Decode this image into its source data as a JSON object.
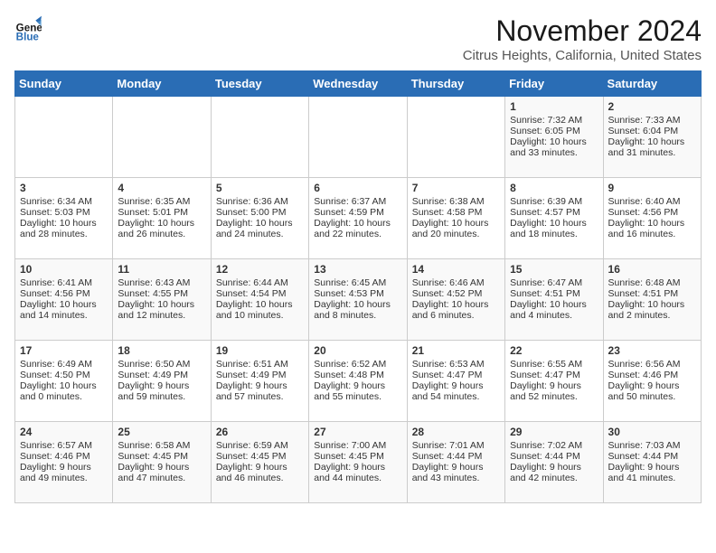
{
  "logo": {
    "line1": "General",
    "line2": "Blue"
  },
  "title": "November 2024",
  "subtitle": "Citrus Heights, California, United States",
  "days_of_week": [
    "Sunday",
    "Monday",
    "Tuesday",
    "Wednesday",
    "Thursday",
    "Friday",
    "Saturday"
  ],
  "weeks": [
    [
      {
        "day": "",
        "sunrise": "",
        "sunset": "",
        "daylight": ""
      },
      {
        "day": "",
        "sunrise": "",
        "sunset": "",
        "daylight": ""
      },
      {
        "day": "",
        "sunrise": "",
        "sunset": "",
        "daylight": ""
      },
      {
        "day": "",
        "sunrise": "",
        "sunset": "",
        "daylight": ""
      },
      {
        "day": "",
        "sunrise": "",
        "sunset": "",
        "daylight": ""
      },
      {
        "day": "1",
        "sunrise": "Sunrise: 7:32 AM",
        "sunset": "Sunset: 6:05 PM",
        "daylight": "Daylight: 10 hours and 33 minutes."
      },
      {
        "day": "2",
        "sunrise": "Sunrise: 7:33 AM",
        "sunset": "Sunset: 6:04 PM",
        "daylight": "Daylight: 10 hours and 31 minutes."
      }
    ],
    [
      {
        "day": "3",
        "sunrise": "Sunrise: 6:34 AM",
        "sunset": "Sunset: 5:03 PM",
        "daylight": "Daylight: 10 hours and 28 minutes."
      },
      {
        "day": "4",
        "sunrise": "Sunrise: 6:35 AM",
        "sunset": "Sunset: 5:01 PM",
        "daylight": "Daylight: 10 hours and 26 minutes."
      },
      {
        "day": "5",
        "sunrise": "Sunrise: 6:36 AM",
        "sunset": "Sunset: 5:00 PM",
        "daylight": "Daylight: 10 hours and 24 minutes."
      },
      {
        "day": "6",
        "sunrise": "Sunrise: 6:37 AM",
        "sunset": "Sunset: 4:59 PM",
        "daylight": "Daylight: 10 hours and 22 minutes."
      },
      {
        "day": "7",
        "sunrise": "Sunrise: 6:38 AM",
        "sunset": "Sunset: 4:58 PM",
        "daylight": "Daylight: 10 hours and 20 minutes."
      },
      {
        "day": "8",
        "sunrise": "Sunrise: 6:39 AM",
        "sunset": "Sunset: 4:57 PM",
        "daylight": "Daylight: 10 hours and 18 minutes."
      },
      {
        "day": "9",
        "sunrise": "Sunrise: 6:40 AM",
        "sunset": "Sunset: 4:56 PM",
        "daylight": "Daylight: 10 hours and 16 minutes."
      }
    ],
    [
      {
        "day": "10",
        "sunrise": "Sunrise: 6:41 AM",
        "sunset": "Sunset: 4:56 PM",
        "daylight": "Daylight: 10 hours and 14 minutes."
      },
      {
        "day": "11",
        "sunrise": "Sunrise: 6:43 AM",
        "sunset": "Sunset: 4:55 PM",
        "daylight": "Daylight: 10 hours and 12 minutes."
      },
      {
        "day": "12",
        "sunrise": "Sunrise: 6:44 AM",
        "sunset": "Sunset: 4:54 PM",
        "daylight": "Daylight: 10 hours and 10 minutes."
      },
      {
        "day": "13",
        "sunrise": "Sunrise: 6:45 AM",
        "sunset": "Sunset: 4:53 PM",
        "daylight": "Daylight: 10 hours and 8 minutes."
      },
      {
        "day": "14",
        "sunrise": "Sunrise: 6:46 AM",
        "sunset": "Sunset: 4:52 PM",
        "daylight": "Daylight: 10 hours and 6 minutes."
      },
      {
        "day": "15",
        "sunrise": "Sunrise: 6:47 AM",
        "sunset": "Sunset: 4:51 PM",
        "daylight": "Daylight: 10 hours and 4 minutes."
      },
      {
        "day": "16",
        "sunrise": "Sunrise: 6:48 AM",
        "sunset": "Sunset: 4:51 PM",
        "daylight": "Daylight: 10 hours and 2 minutes."
      }
    ],
    [
      {
        "day": "17",
        "sunrise": "Sunrise: 6:49 AM",
        "sunset": "Sunset: 4:50 PM",
        "daylight": "Daylight: 10 hours and 0 minutes."
      },
      {
        "day": "18",
        "sunrise": "Sunrise: 6:50 AM",
        "sunset": "Sunset: 4:49 PM",
        "daylight": "Daylight: 9 hours and 59 minutes."
      },
      {
        "day": "19",
        "sunrise": "Sunrise: 6:51 AM",
        "sunset": "Sunset: 4:49 PM",
        "daylight": "Daylight: 9 hours and 57 minutes."
      },
      {
        "day": "20",
        "sunrise": "Sunrise: 6:52 AM",
        "sunset": "Sunset: 4:48 PM",
        "daylight": "Daylight: 9 hours and 55 minutes."
      },
      {
        "day": "21",
        "sunrise": "Sunrise: 6:53 AM",
        "sunset": "Sunset: 4:47 PM",
        "daylight": "Daylight: 9 hours and 54 minutes."
      },
      {
        "day": "22",
        "sunrise": "Sunrise: 6:55 AM",
        "sunset": "Sunset: 4:47 PM",
        "daylight": "Daylight: 9 hours and 52 minutes."
      },
      {
        "day": "23",
        "sunrise": "Sunrise: 6:56 AM",
        "sunset": "Sunset: 4:46 PM",
        "daylight": "Daylight: 9 hours and 50 minutes."
      }
    ],
    [
      {
        "day": "24",
        "sunrise": "Sunrise: 6:57 AM",
        "sunset": "Sunset: 4:46 PM",
        "daylight": "Daylight: 9 hours and 49 minutes."
      },
      {
        "day": "25",
        "sunrise": "Sunrise: 6:58 AM",
        "sunset": "Sunset: 4:45 PM",
        "daylight": "Daylight: 9 hours and 47 minutes."
      },
      {
        "day": "26",
        "sunrise": "Sunrise: 6:59 AM",
        "sunset": "Sunset: 4:45 PM",
        "daylight": "Daylight: 9 hours and 46 minutes."
      },
      {
        "day": "27",
        "sunrise": "Sunrise: 7:00 AM",
        "sunset": "Sunset: 4:45 PM",
        "daylight": "Daylight: 9 hours and 44 minutes."
      },
      {
        "day": "28",
        "sunrise": "Sunrise: 7:01 AM",
        "sunset": "Sunset: 4:44 PM",
        "daylight": "Daylight: 9 hours and 43 minutes."
      },
      {
        "day": "29",
        "sunrise": "Sunrise: 7:02 AM",
        "sunset": "Sunset: 4:44 PM",
        "daylight": "Daylight: 9 hours and 42 minutes."
      },
      {
        "day": "30",
        "sunrise": "Sunrise: 7:03 AM",
        "sunset": "Sunset: 4:44 PM",
        "daylight": "Daylight: 9 hours and 41 minutes."
      }
    ]
  ]
}
